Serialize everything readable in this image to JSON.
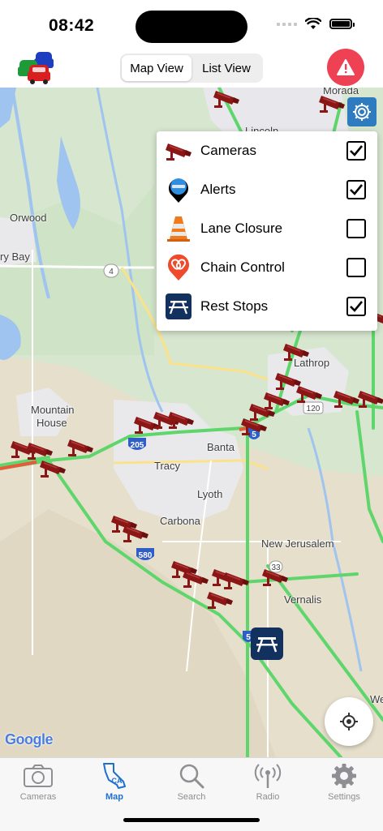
{
  "status_bar": {
    "time": "08:42"
  },
  "header": {
    "segments": [
      {
        "label": "Map View",
        "active": true
      },
      {
        "label": "List View",
        "active": false
      }
    ],
    "alert_icon": "alert-triangle-icon",
    "logo_icon": "cars-logo-icon"
  },
  "map": {
    "places": [
      {
        "name": "Morada"
      },
      {
        "name": "Lincoln"
      },
      {
        "name": "Orwood"
      },
      {
        "name": "ry Bay"
      },
      {
        "name": "Lathrop"
      },
      {
        "name": "Mountain"
      },
      {
        "name": "House"
      },
      {
        "name": "Banta"
      },
      {
        "name": "Tracy"
      },
      {
        "name": "Lyoth"
      },
      {
        "name": "Carbona"
      },
      {
        "name": "New Jerusalem"
      },
      {
        "name": "Vernalis"
      },
      {
        "name": "We"
      }
    ],
    "shields": {
      "r4": "4",
      "r120": "120",
      "i205": "205",
      "i5a": "5",
      "i580": "580",
      "i5b": "5",
      "r33": "33"
    },
    "attribution": "Google",
    "camera_count": 26
  },
  "layers_panel": {
    "items": [
      {
        "label": "Cameras",
        "icon": "camera-icon",
        "checked": true
      },
      {
        "label": "Alerts",
        "icon": "alert-pin-icon",
        "checked": true
      },
      {
        "label": "Lane Closure",
        "icon": "traffic-cone-icon",
        "checked": false
      },
      {
        "label": "Chain Control",
        "icon": "chain-control-icon",
        "checked": false
      },
      {
        "label": "Rest Stops",
        "icon": "picnic-table-icon",
        "checked": true
      }
    ]
  },
  "tabbar": {
    "tabs": [
      {
        "label": "Cameras",
        "icon": "camera-icon",
        "active": false
      },
      {
        "label": "Map",
        "icon": "california-map-icon",
        "active": true
      },
      {
        "label": "Search",
        "icon": "search-icon",
        "active": false
      },
      {
        "label": "Radio",
        "icon": "radio-icon",
        "active": false
      },
      {
        "label": "Settings",
        "icon": "gear-icon",
        "active": false
      }
    ]
  },
  "colors": {
    "accent_blue": "#1f6fd1",
    "alert_red": "#ef4154",
    "camera_red": "#8b1616",
    "traffic_green": "#5ed66b",
    "rest_stop_navy": "#12315e"
  }
}
